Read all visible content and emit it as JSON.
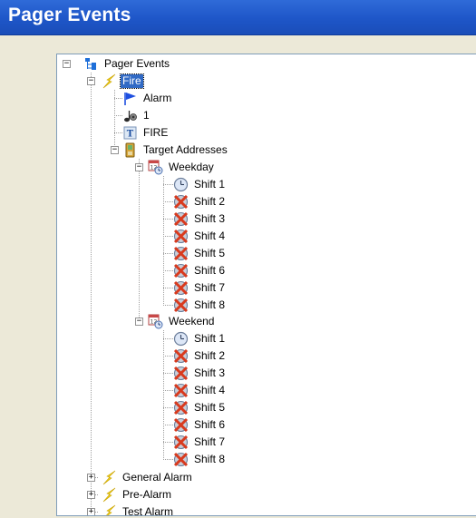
{
  "window": {
    "title": "Pager Events"
  },
  "tree": {
    "root": {
      "label": "Pager Events",
      "icon": "tree-root-icon"
    },
    "fire": {
      "label": "Fire",
      "children": {
        "alarm": "Alarm",
        "number": "1",
        "text": "FIRE",
        "targets": "Target Addresses"
      },
      "weekday": {
        "label": "Weekday",
        "shifts": [
          "Shift 1",
          "Shift 2",
          "Shift 3",
          "Shift 4",
          "Shift 5",
          "Shift 6",
          "Shift 7",
          "Shift 8"
        ]
      },
      "weekend": {
        "label": "Weekend",
        "shifts": [
          "Shift 1",
          "Shift 2",
          "Shift 3",
          "Shift 4",
          "Shift 5",
          "Shift 6",
          "Shift 7",
          "Shift 8"
        ]
      }
    },
    "siblings": [
      "General Alarm",
      "Pre-Alarm",
      "Test Alarm"
    ],
    "expander_expanded": "−",
    "expander_collapsed": "+"
  },
  "colors": {
    "title_bar": "#1E56C8",
    "selection": "#316AC5",
    "lightning": "#F3D21B",
    "flag": "#1E4FE0",
    "disabled_shift": "#D93A1E"
  }
}
